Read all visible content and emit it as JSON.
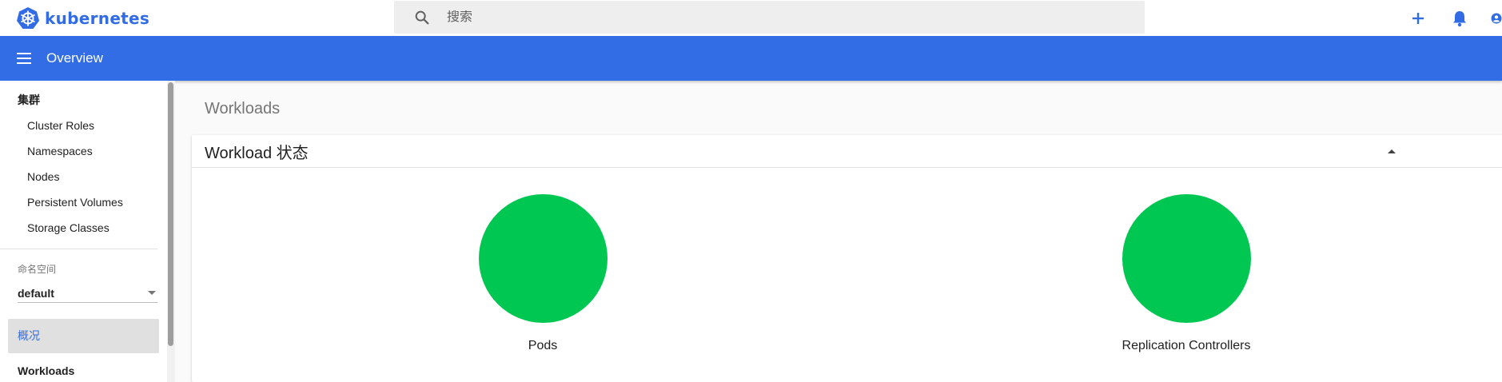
{
  "header": {
    "brand": "kubernetes",
    "search_placeholder": "搜索",
    "actions": [
      "add-icon",
      "bell-icon",
      "account-icon"
    ]
  },
  "toolbar": {
    "title": "Overview"
  },
  "sidebar": {
    "cluster_title": "集群",
    "cluster_items": [
      {
        "label": "Cluster Roles"
      },
      {
        "label": "Namespaces"
      },
      {
        "label": "Nodes"
      },
      {
        "label": "Persistent Volumes"
      },
      {
        "label": "Storage Classes"
      }
    ],
    "namespace_label": "命名空间",
    "namespace_value": "default",
    "overview_label": "概况",
    "workloads_label": "Workloads"
  },
  "main": {
    "title": "Workloads",
    "card_title": "Workload 状态",
    "statuses": [
      {
        "label": "Pods",
        "color": "#00c752"
      },
      {
        "label": "Replication Controllers",
        "color": "#00c752"
      }
    ]
  },
  "colors": {
    "brand": "#326ce5",
    "toolbar": "#326de6",
    "running": "#00c752"
  }
}
